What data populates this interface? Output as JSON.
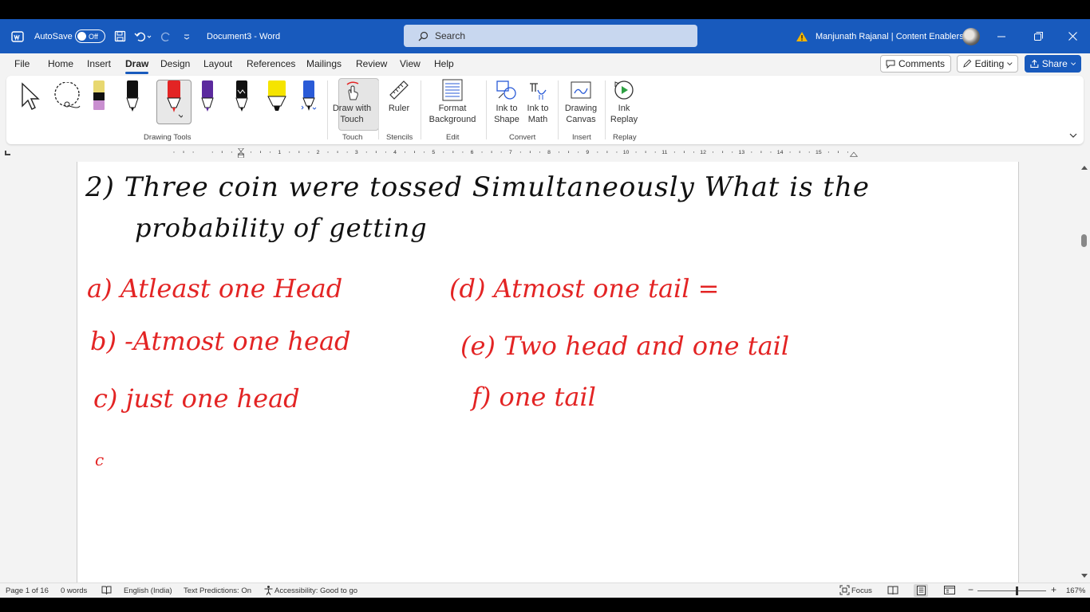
{
  "titlebar": {
    "autosave_label": "AutoSave",
    "autosave_state": "Off",
    "doc_title": "Document3  -  Word",
    "search_placeholder": "Search",
    "user": "Manjunath Rajanal | Content Enablers"
  },
  "menu": {
    "tabs": [
      "File",
      "Home",
      "Insert",
      "Draw",
      "Design",
      "Layout",
      "References",
      "Mailings",
      "Review",
      "View",
      "Help"
    ],
    "active_tab": "Draw",
    "comments": "Comments",
    "editing": "Editing",
    "share": "Share"
  },
  "ribbon": {
    "groups": {
      "drawing_tools": "Drawing Tools",
      "touch": "Touch",
      "stencils": "Stencils",
      "edit": "Edit",
      "convert": "Convert",
      "insert": "Insert",
      "replay": "Replay"
    },
    "buttons": {
      "draw_with_touch_1": "Draw with",
      "draw_with_touch_2": "Touch",
      "ruler": "Ruler",
      "format_bg_1": "Format",
      "format_bg_2": "Background",
      "ink_to_shape_1": "Ink to",
      "ink_to_shape_2": "Shape",
      "ink_to_math_1": "Ink to",
      "ink_to_math_2": "Math",
      "drawing_canvas_1": "Drawing",
      "drawing_canvas_2": "Canvas",
      "ink_replay_1": "Ink",
      "ink_replay_2": "Replay"
    },
    "pen_colors": [
      "#e8d870",
      "#111111",
      "#e32424",
      "#5b2a9e",
      "#111111",
      "#f5e400",
      "#2a5bd7"
    ]
  },
  "ruler": {
    "numbers": [
      "1",
      "2",
      "3",
      "4",
      "5",
      "6",
      "7",
      "8",
      "9",
      "10",
      "11",
      "12",
      "13",
      "14",
      "15"
    ]
  },
  "ink": {
    "question_line1": "2)  Three  coin  were  tossed  Simultaneously  What is the",
    "question_line2": "probability  of  getting",
    "a": "a) Atleast  one  Head",
    "b": "b) -Atmost  one head",
    "c": "c) just  one head",
    "d": "(d) Atmost  one tail  =",
    "e": "(e) Two  head  and one tail",
    "f": "f)  one tail",
    "stray": "c"
  },
  "status": {
    "page": "Page 1 of 16",
    "words": "0 words",
    "language": "English (India)",
    "predictions": "Text Predictions: On",
    "accessibility": "Accessibility: Good to go",
    "focus": "Focus",
    "zoom": "167%"
  }
}
